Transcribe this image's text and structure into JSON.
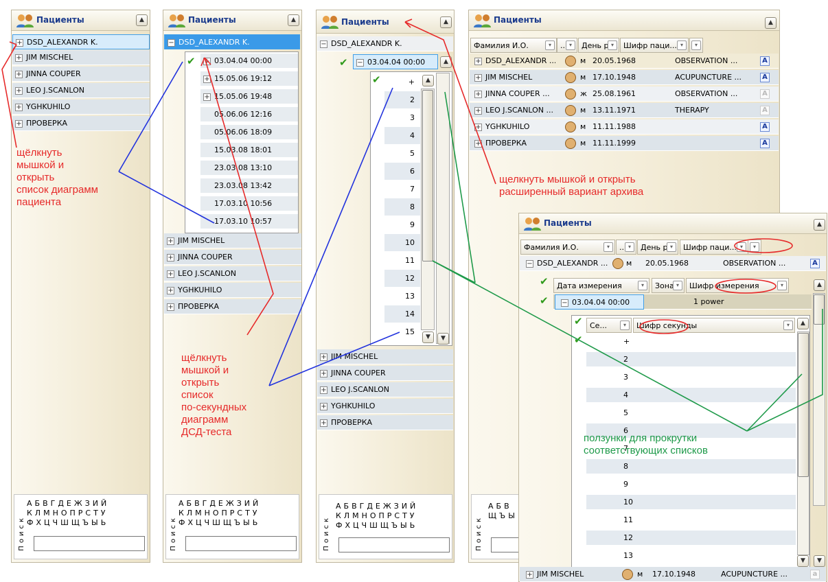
{
  "panel_title": "Пациенты",
  "patients": [
    "DSD_ALEXANDR K.",
    "JIM MISCHEL",
    "JINNA COUPER",
    "LEO J.SCANLON",
    "YGHKUHILO",
    "ПРОВЕРКА"
  ],
  "dates": [
    "03.04.04 00:00",
    "15.05.06 19:12",
    "15.05.06 19:48",
    "05.06.06 12:16",
    "05.06.06 18:09",
    "15.03.08 18:01",
    "23.03.08 13:10",
    "23.03.08 13:42",
    "17.03.10 10:56",
    "17.03.10 10:57"
  ],
  "seconds": [
    "+",
    "2",
    "3",
    "4",
    "5",
    "6",
    "7",
    "8",
    "9",
    "10",
    "11",
    "12",
    "13",
    "14",
    "15"
  ],
  "alphabet": {
    "line1": "АБВГДЕЖЗИЙ",
    "line2": "КЛМНОПРСТУ",
    "line3": "ФХЦЧШЩЪЫЬ",
    "line2_partial": "ЩЪЫ",
    "line1_partial": "АБВ"
  },
  "search_label": "Поиск",
  "grid": {
    "headers": [
      "Фамилия И.О.",
      "...",
      "День ро...",
      "Шифр паци...",
      "."
    ],
    "rows": [
      {
        "name": "DSD_ALEXANDR ...",
        "sex": "м",
        "dob": "20.05.1968",
        "code": "OBSERVATION ..."
      },
      {
        "name": "JIM MISCHEL",
        "sex": "м",
        "dob": "17.10.1948",
        "code": "ACUPUNCTURE ..."
      },
      {
        "name": "JINNA COUPER ...",
        "sex": "ж",
        "dob": "25.08.1961",
        "code": "OBSERVATION ..."
      },
      {
        "name": "LEO J.SCANLON ...",
        "sex": "м",
        "dob": "13.11.1971",
        "code": "THERAPY"
      },
      {
        "name": "YGHKUHILO",
        "sex": "м",
        "dob": "11.11.1988",
        "code": ""
      },
      {
        "name": "ПРОВЕРКА",
        "sex": "м",
        "dob": "11.11.1999",
        "code": ""
      }
    ]
  },
  "detail": {
    "sub_headers": [
      "Дата измерения",
      "Зона",
      "Шифр измерения"
    ],
    "meas_date": "03.04.04 00:00",
    "meas_zone": "1 power",
    "sec_headers": [
      "Се...",
      "Шифр секунды"
    ],
    "sec_values": [
      "+",
      "2",
      "3",
      "4",
      "5",
      "6",
      "7",
      "8",
      "9",
      "10",
      "11",
      "12",
      "13"
    ],
    "bottom_row": {
      "name": "JIM MISCHEL",
      "sex": "м",
      "dob": "17.10.1948",
      "code": "ACUPUNCTURE ..."
    }
  },
  "annotations": {
    "a1": [
      "щёлкнуть",
      "мышкой и",
      "открыть",
      "список диаграмм",
      "пациента"
    ],
    "a2": [
      "щёлкнуть",
      "мышкой и",
      "открыть",
      "список",
      "по-секундных",
      "диаграмм",
      "ДСД-теста"
    ],
    "a3": [
      "щелкнуть мышкой и открыть",
      "расширенный  вариант архива"
    ],
    "a4": [
      "ползунки для прокрутки",
      "соответствующих списков"
    ]
  },
  "colors": {
    "red": "#e62a2a",
    "green": "#1f9a4a",
    "blue": "#2233dd",
    "selection": "#d7ecfb"
  }
}
